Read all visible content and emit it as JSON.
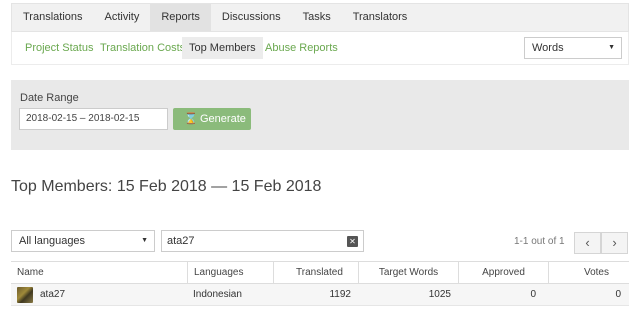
{
  "main_tabs": [
    {
      "label": "Translations"
    },
    {
      "label": "Activity"
    },
    {
      "label": "Reports"
    },
    {
      "label": "Discussions"
    },
    {
      "label": "Tasks"
    },
    {
      "label": "Translators"
    }
  ],
  "active_main_tab": "Reports",
  "sub_tabs": [
    {
      "label": "Project Status"
    },
    {
      "label": "Translation Costs"
    },
    {
      "label": "Top Members"
    },
    {
      "label": "Abuse Reports"
    }
  ],
  "active_sub_tab": "Top Members",
  "words_select": {
    "value": "Words"
  },
  "date_range": {
    "label": "Date Range",
    "value": "2018-02-15 – 2018-02-15",
    "generate_label": "Generate"
  },
  "page_title": "Top Members: 15 Feb 2018 — 15 Feb 2018",
  "filters": {
    "language": "All languages",
    "search_value": "ata27",
    "pagination": "1-1 out of 1",
    "prev": "‹",
    "next": "›"
  },
  "table": {
    "columns": [
      "Name",
      "Languages",
      "Translated",
      "Target Words",
      "Approved",
      "Votes"
    ],
    "sort_indicator": "▼",
    "rows": [
      {
        "name": "ata27",
        "languages": "Indonesian",
        "translated": "1192",
        "target_words": "1025",
        "approved": "0",
        "votes": "0"
      }
    ]
  },
  "colors": {
    "accent": "#6aa84f",
    "generate_button": "#8bbb7b"
  },
  "icons": {
    "generate": "hourglass-icon",
    "clear": "close-icon"
  }
}
